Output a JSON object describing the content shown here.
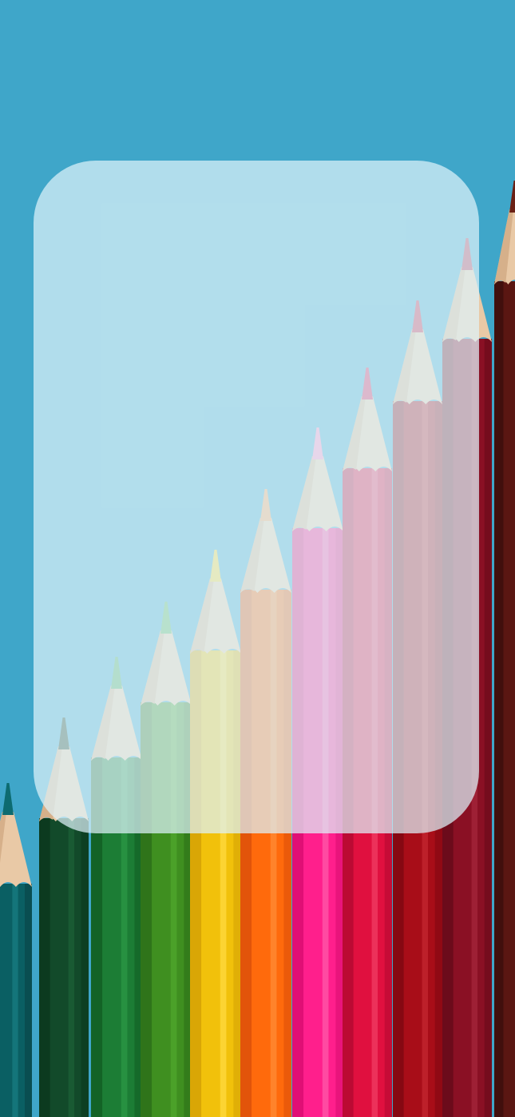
{
  "background": {
    "description_tags": [
      "colored-pencils-photo"
    ],
    "base_color": "#3fa6c9",
    "pencils": [
      {
        "name": "teal",
        "body": "#0a5f63",
        "dark": "#08474a",
        "light": "#177a80",
        "lead": "#0d6b70"
      },
      {
        "name": "dark-green",
        "body": "#124a2a",
        "dark": "#0c3a1f",
        "light": "#1c5e36",
        "lead": "#163f26"
      },
      {
        "name": "green",
        "body": "#1c7d35",
        "dark": "#136326",
        "light": "#2a9645",
        "lead": "#49a95b"
      },
      {
        "name": "leaf-green",
        "body": "#3f8f20",
        "dark": "#2f741a",
        "light": "#4fa52c",
        "lead": "#56b45a"
      },
      {
        "name": "yellow",
        "body": "#f1c10b",
        "dark": "#d9a606",
        "light": "#ffd83d",
        "lead": "#f7d534"
      },
      {
        "name": "orange",
        "body": "#ff6a0c",
        "dark": "#e2540a",
        "light": "#ff8a33",
        "lead": "#f7a35e"
      },
      {
        "name": "pink",
        "body": "#ff1f8c",
        "dark": "#e00f75",
        "light": "#ff55a8",
        "lead": "#ff8dc0"
      },
      {
        "name": "red",
        "body": "#e0103f",
        "dark": "#bb0a33",
        "light": "#ef3a62",
        "lead": "#d6275b"
      },
      {
        "name": "dark-red",
        "body": "#a80d18",
        "dark": "#860812",
        "light": "#c22530",
        "lead": "#c92a4a"
      },
      {
        "name": "maroon",
        "body": "#8a1024",
        "dark": "#6c0b1b",
        "light": "#a2243a",
        "lead": "#b53450"
      },
      {
        "name": "brown",
        "body": "#5a1612",
        "dark": "#410f0d",
        "light": "#73211c",
        "lead": "#6a2015"
      }
    ],
    "wood_color": "#e9c9a6",
    "wood_shadow": "#d6b08a"
  },
  "card": {
    "fill": "rgba(222, 243, 250, 0.72)"
  }
}
